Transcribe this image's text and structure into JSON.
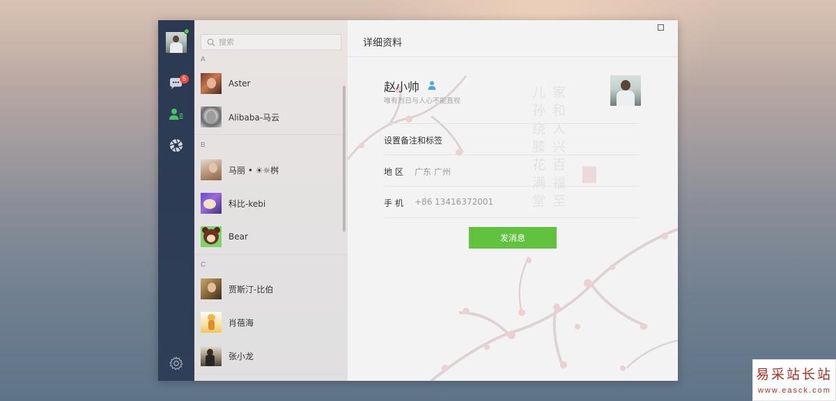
{
  "sidebar": {
    "unread_badge": "5",
    "icons": [
      "chat-icon",
      "contacts-icon",
      "moments-icon",
      "settings-icon"
    ]
  },
  "contacts": {
    "search_placeholder": "搜索",
    "groups": [
      {
        "letter": "A",
        "items": [
          "Aster",
          "Alibaba-马云"
        ]
      },
      {
        "letter": "B",
        "items": [
          "马丽 • ☀☼桝",
          "科比-kebi",
          "Bear"
        ]
      },
      {
        "letter": "C",
        "items": [
          "贾斯汀-比伯",
          "肖蓓海",
          "张小龙"
        ]
      }
    ]
  },
  "detail": {
    "title": "详细资料",
    "name": "赵小帅",
    "signature": "唯有烈日与人心不能直视",
    "remark_label": "设置备注和标签",
    "region_label": "地 区",
    "region_value": "广东 广州",
    "phone_label": "手 机",
    "phone_value": "+86 13416372001",
    "send_button": "发消息"
  },
  "watermark": {
    "title": "易采站长站",
    "url": "www.easck.com"
  },
  "colors": {
    "rail": "#2b3a52",
    "accent_green": "#61c23d",
    "badge_red": "#e84a3d",
    "contacts_icon_green": "#4cbf6a"
  }
}
